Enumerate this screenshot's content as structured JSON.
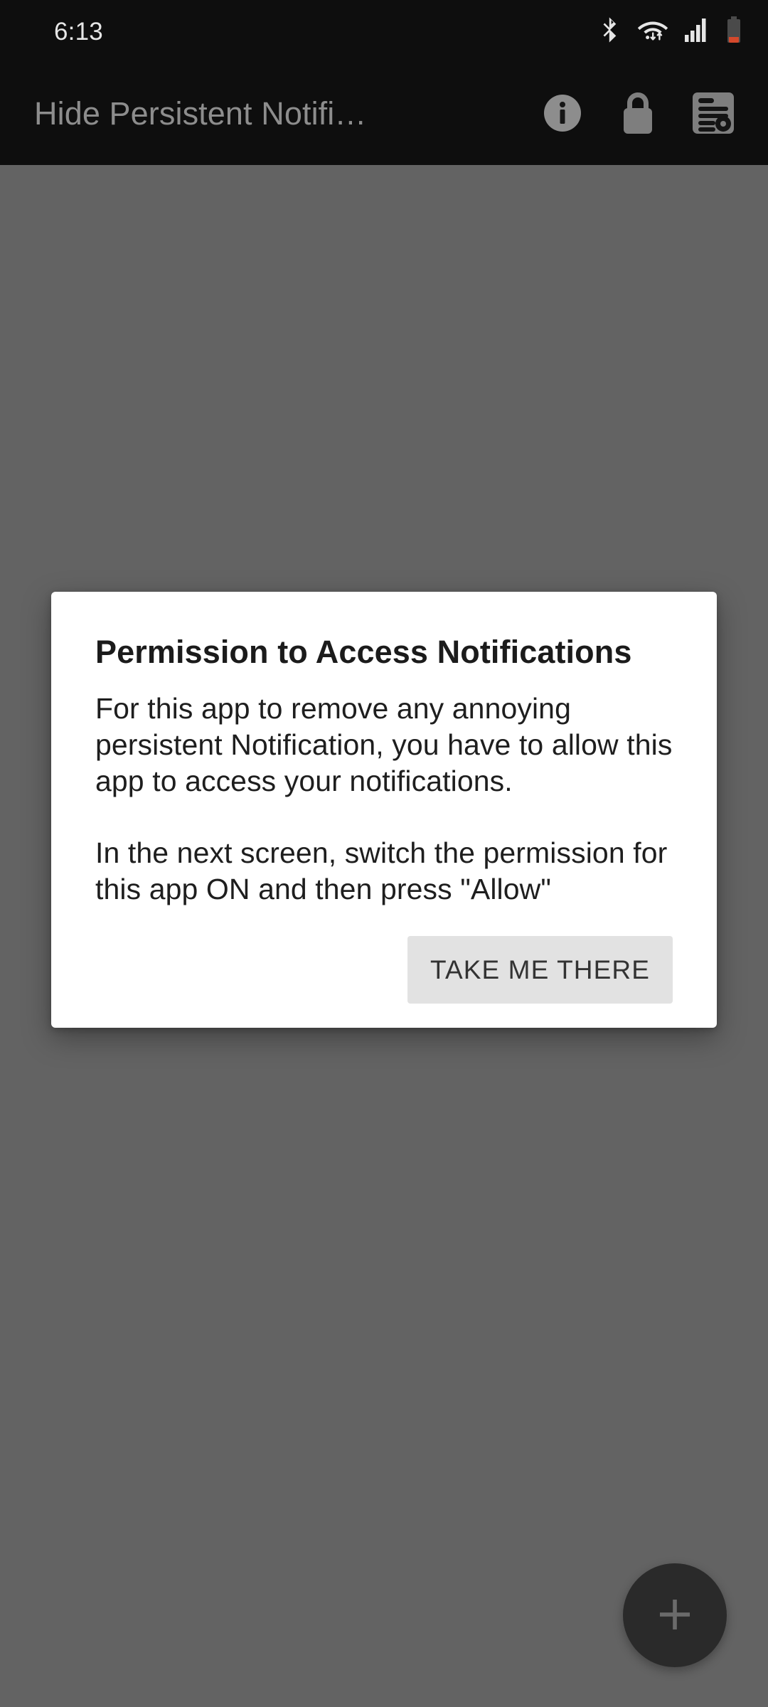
{
  "status_bar": {
    "clock": "6:13",
    "icons": [
      {
        "name": "bluetooth-icon",
        "label": "Bluetooth"
      },
      {
        "name": "wifi-icon",
        "label": "Wi-Fi with data transfer"
      },
      {
        "name": "cellular-signal-icon",
        "label": "Cellular signal"
      },
      {
        "name": "battery-low-icon",
        "label": "Battery low"
      }
    ],
    "battery_color": "#d4492c",
    "background": "#0e0e0e",
    "foreground": "#e6e6e6"
  },
  "app_bar": {
    "title": "Hide Persistent Notifi…",
    "title_color": "#8d8d8d",
    "background": "#0e0e0e",
    "actions": [
      {
        "name": "info-icon",
        "label": "Info"
      },
      {
        "name": "lock-icon",
        "label": "Lock"
      },
      {
        "name": "notification-list-icon",
        "label": "Notifications"
      }
    ]
  },
  "scrim": {
    "color": "#636363"
  },
  "fab": {
    "name": "add-fab",
    "icon": "plus-icon",
    "label": "Add",
    "background": "#2a2a2a",
    "icon_color": "#6b6b6b"
  },
  "dialog": {
    "title": "Permission to Access Notifications",
    "message": "For this app to remove any annoying persistent Notification, you have to allow this app to access your notifications.\n\nIn the next screen, switch the permission for this app ON and then press \"Allow\"",
    "background": "#ffffff",
    "primary_button": {
      "label": "TAKE ME THERE",
      "background": "#e2e2e2",
      "text_color": "#333333"
    }
  }
}
